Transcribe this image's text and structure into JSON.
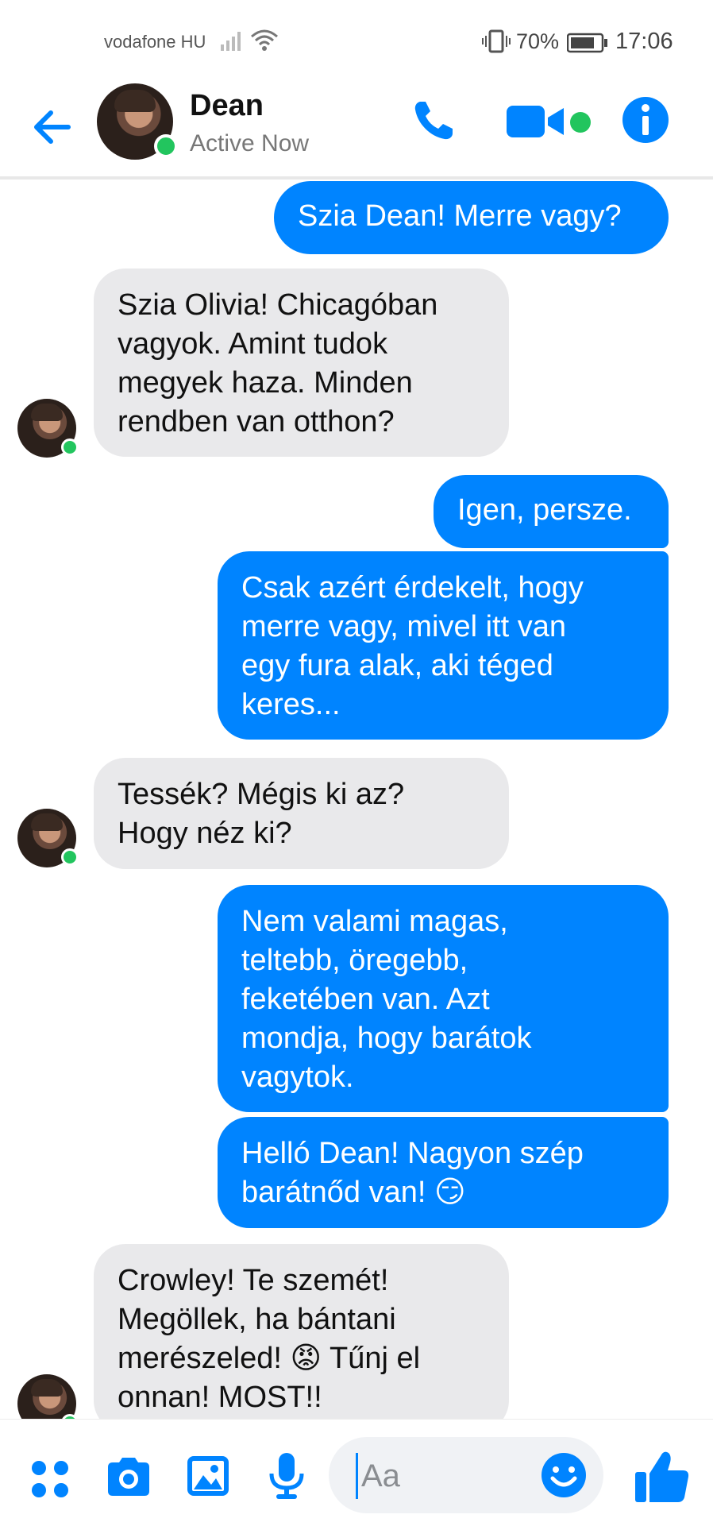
{
  "status_bar": {
    "carrier": "vodafone HU",
    "battery_pct": "70%",
    "time": "17:06"
  },
  "header": {
    "contact_name": "Dean",
    "contact_status": "Active Now"
  },
  "messages": [
    {
      "from": "me",
      "text": "Szia Dean! Merre vagy?"
    },
    {
      "from": "dean",
      "text": "Szia Olivia! Chicagóban\nvagyok. Amint tudok\nmegyek haza. Minden\nrendben van otthon?"
    },
    {
      "from": "me",
      "text": "Igen, persze."
    },
    {
      "from": "me",
      "text": "Csak azért érdekelt, hogy\nmerre vagy, mivel itt van\negy fura alak, aki téged\nkeres..."
    },
    {
      "from": "dean",
      "text": "Tessék? Mégis ki az?\nHogy néz ki?"
    },
    {
      "from": "me",
      "text": "Nem valami magas,\nteltebb, öregebb,\nfeketében van. Azt\nmondja, hogy barátok\nvagytok."
    },
    {
      "from": "me",
      "text": "Helló Dean! Nagyon szép\nbarátnőd van! ",
      "emoji": "😏"
    },
    {
      "from": "dean",
      "text_a": "Crowley! Te szemét!\nMegöllek, ha bántani\nmerészeled! ",
      "emoji": "😡",
      "text_b": " Tűnj el\nonnan! MOST!!"
    }
  ],
  "composer": {
    "placeholder": "Aa"
  },
  "colors": {
    "accent": "#0084ff",
    "incoming_bubble": "#e9e9eb",
    "online": "#22c55e"
  }
}
